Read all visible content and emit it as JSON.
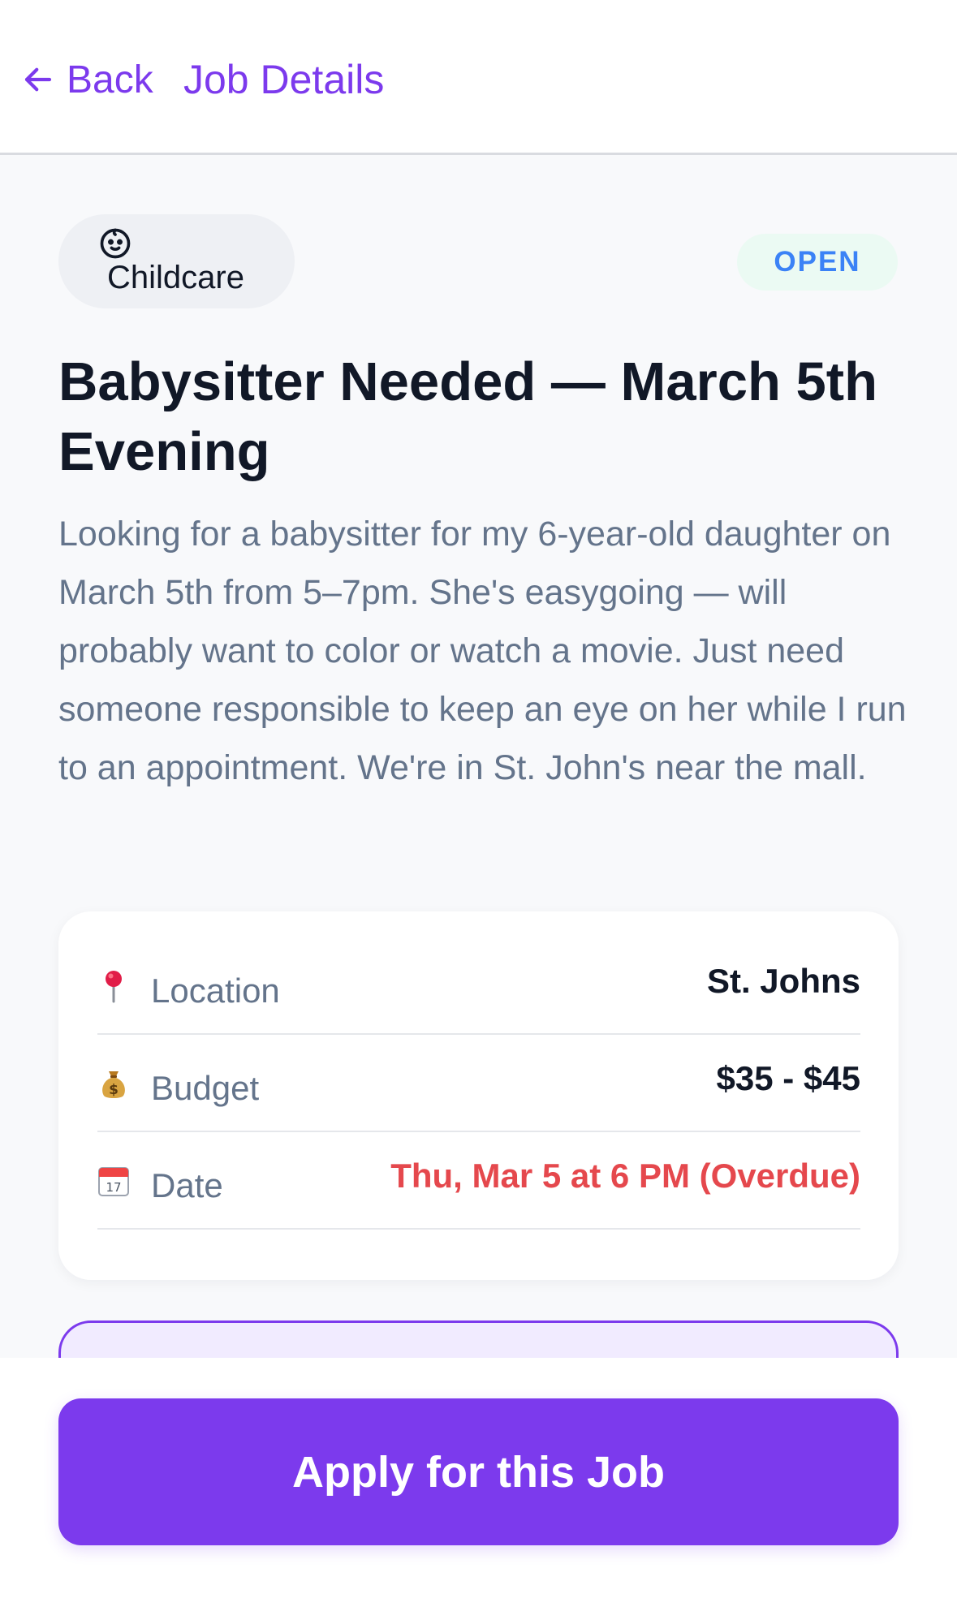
{
  "header": {
    "back_label": "Back",
    "title": "Job Details"
  },
  "job": {
    "category": {
      "label": "Childcare",
      "icon": "baby-face-icon"
    },
    "status": "OPEN",
    "title": "Babysitter Needed — March 5th Evening",
    "description": "Looking for a babysitter for my 6-year-old daughter on March 5th from 5–7pm. She's easygoing — will probably want to color or watch a movie. Just need someone responsible to keep an eye on her while I run to an appointment. We're in St. John's near the mall."
  },
  "details": {
    "location": {
      "label": "Location",
      "value": "St. Johns",
      "icon": "pin-icon"
    },
    "budget": {
      "label": "Budget",
      "value": "$35 - $45",
      "icon": "money-bag-icon"
    },
    "date": {
      "label": "Date",
      "value": "Thu, Mar 5 at 6 PM (Overdue)",
      "icon": "calendar-icon"
    }
  },
  "actions": {
    "apply_label": "Apply for this Job"
  },
  "colors": {
    "accent": "#7c3aed",
    "status_open": "#3b82f6",
    "overdue": "#e5484d"
  }
}
